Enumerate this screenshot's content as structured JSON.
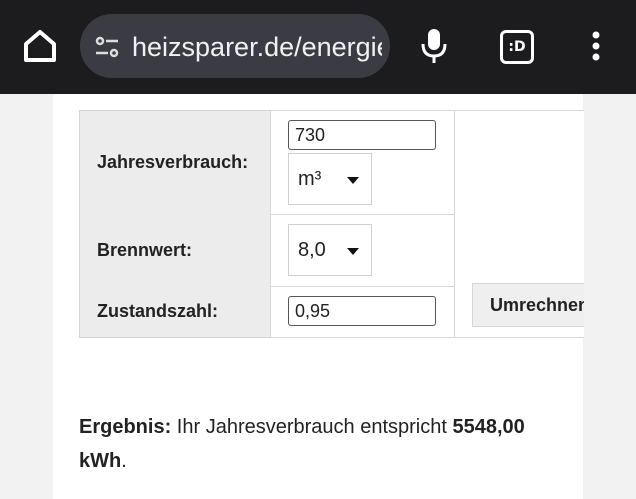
{
  "browser": {
    "url": "heizsparer.de/energie",
    "icons": {
      "home": "home-icon",
      "site_settings": "tune-icon",
      "mic": "microphone-icon",
      "tab_switcher": "tab-switcher-icon",
      "menu": "more-vert-icon"
    },
    "tab_label": ":D"
  },
  "calculator": {
    "rows": {
      "jahresverbrauch": {
        "label": "Jahresverbrauch:",
        "value": "730",
        "unit": "m³"
      },
      "brennwert": {
        "label": "Brennwert:",
        "value": "8,0"
      },
      "zustandszahl": {
        "label": "Zustandszahl:",
        "value": "0,95"
      }
    },
    "convert_label": "Umrechnen"
  },
  "result": {
    "label": "Ergebnis:",
    "text": " Ihr Jahresverbrauch entspricht ",
    "value": "5548,00 kWh",
    "suffix": "."
  },
  "colors": {
    "topbar": "#1c1c1f",
    "urlbar": "#3b3b44",
    "page_bg": "#ffffff",
    "label_col_bg": "#ececec"
  }
}
